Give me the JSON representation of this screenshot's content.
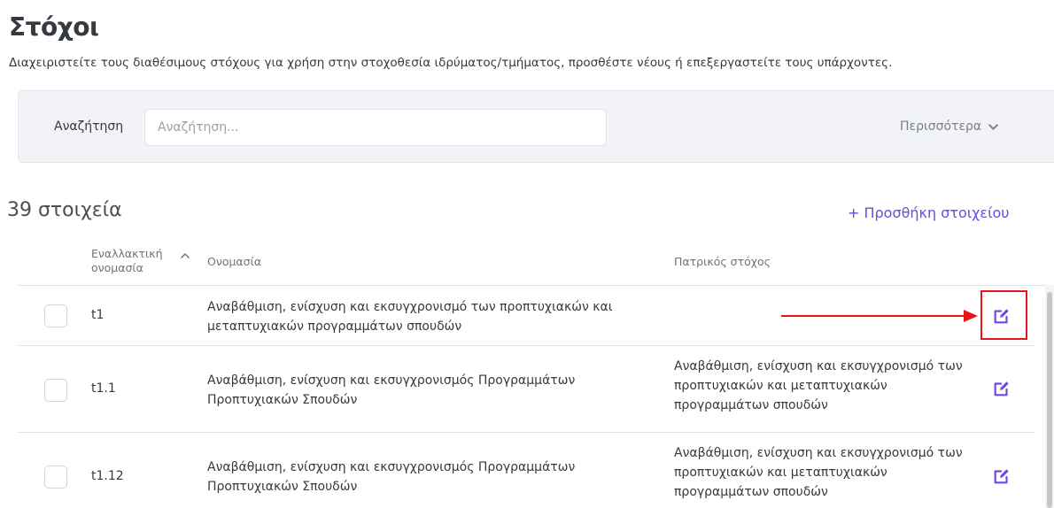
{
  "page": {
    "title": "Στόχοι",
    "description": "Διαχειριστείτε τους διαθέσιμους στόχους για χρήση στην στοχοθεσία ιδρύματος/τμήματος, προσθέστε νέους ή επεξεργαστείτε τους υπάρχοντες."
  },
  "search": {
    "label": "Αναζήτηση",
    "placeholder": "Αναζήτηση...",
    "value": "",
    "more_label": "Περισσότερα"
  },
  "list": {
    "count_label": "39 στοιχεία",
    "add_label": "+ Προσθήκη στοιχείου"
  },
  "table": {
    "headers": {
      "alt_name": "Εναλλακτική ονομασία",
      "name": "Ονομασία",
      "parent": "Πατρικός στόχος"
    },
    "rows": [
      {
        "alt": "t1",
        "name": "Αναβάθμιση, ενίσχυση και εκσυγχρονισμό των προπτυχιακών και μεταπτυχιακών προγραμμάτων σπουδών",
        "parent": ""
      },
      {
        "alt": "t1.1",
        "name": "Αναβάθμιση, ενίσχυση και εκσυγχρονισμός Προγραμμάτων Προπτυχιακών Σπουδών",
        "parent": "Αναβάθμιση, ενίσχυση και εκσυγχρονισμό των προπτυχιακών και μεταπτυχιακών προγραμμάτων σπουδών"
      },
      {
        "alt": "t1.12",
        "name": "Αναβάθμιση, ενίσχυση και εκσυγχρονισμός Προγραμμάτων Προπτυχιακών Σπουδών",
        "parent": "Αναβάθμιση, ενίσχυση και εκσυγχρονισμό των προπτυχιακών και μεταπτυχιακών προγραμμάτων σπουδών"
      }
    ]
  },
  "icons": {
    "sort": "chevron-up-icon",
    "more": "chevron-down-icon",
    "edit": "edit-icon"
  },
  "colors": {
    "accent": "#7047e8",
    "annotation": "#e8141b",
    "panel_bg": "#f1f3f6"
  }
}
